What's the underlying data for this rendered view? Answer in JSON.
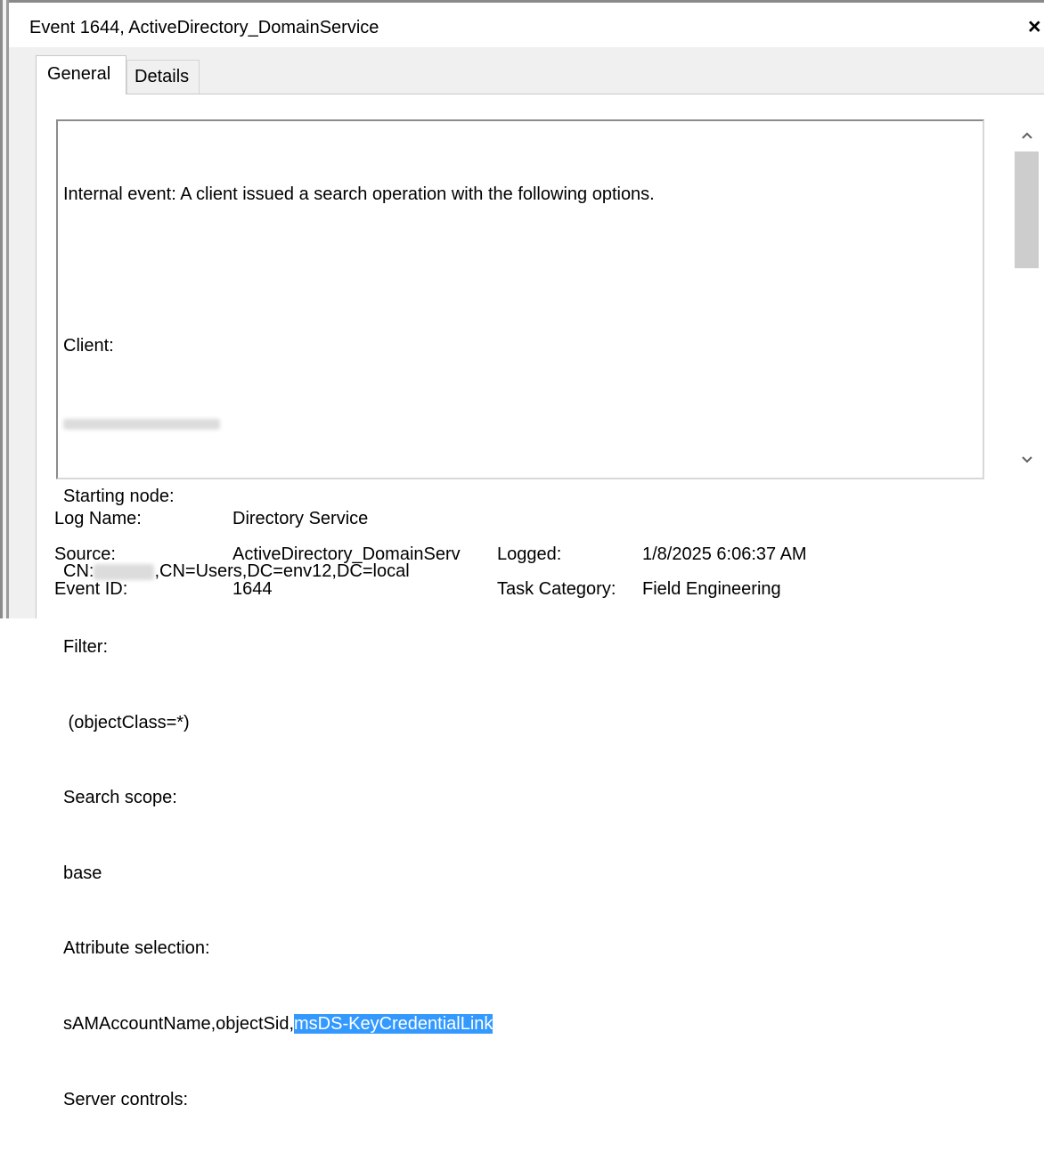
{
  "window": {
    "title": "Event 1644, ActiveDirectory_DomainService",
    "close_glyph": "×"
  },
  "tabs": [
    {
      "label": "General"
    },
    {
      "label": "Details"
    }
  ],
  "message": {
    "lines": [
      "Internal event: A client issued a search operation with the following options.",
      "",
      "Client:",
      "",
      "Starting node:",
      "CN:",
      "Filter:",
      " (objectClass=*)",
      "Search scope:",
      "base",
      "Attribute selection:",
      "sAMAccountName,objectSid,",
      "Server controls:"
    ],
    "cn_suffix": ",CN=Users,DC=env12,DC=local",
    "selected_text": "msDS-KeyCredentialLink"
  },
  "fields": {
    "log_name_label": "Log Name:",
    "log_name_value": "Directory Service",
    "source_label": "Source:",
    "source_value": "ActiveDirectory_DomainServ",
    "logged_label": "Logged:",
    "logged_value": "1/8/2025 6:06:37 AM",
    "event_id_label": "Event ID:",
    "event_id_value": "1644",
    "task_category_label": "Task Category:",
    "task_category_value": "Field Engineering"
  },
  "colors": {
    "selection": "#3399ff",
    "selection_text": "#ffffff"
  }
}
